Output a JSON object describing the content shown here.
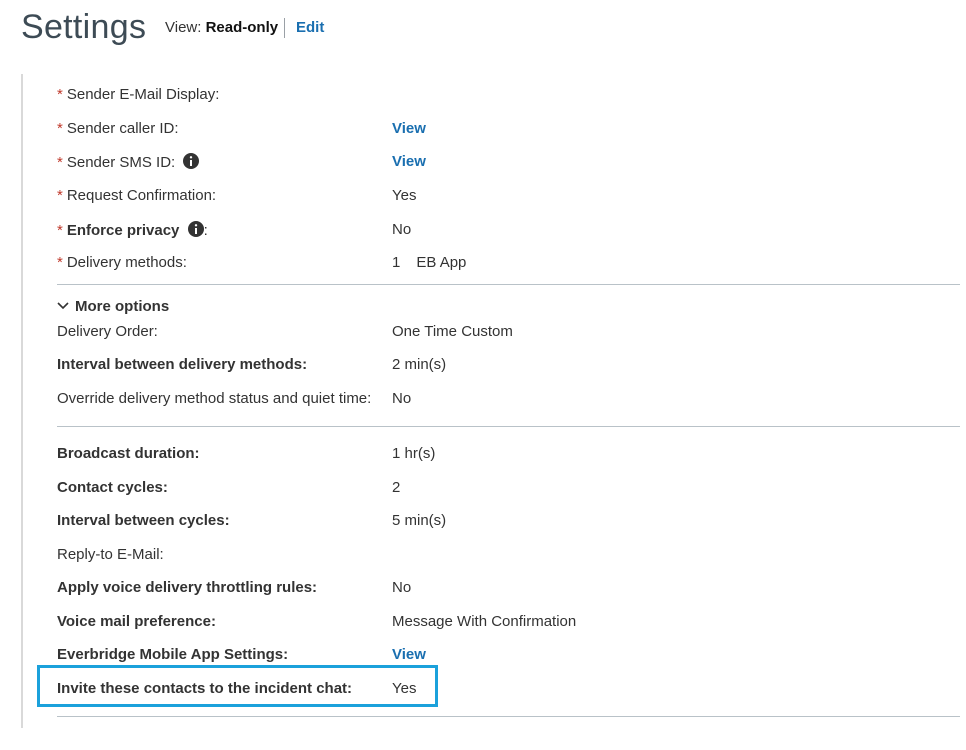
{
  "header": {
    "title": "Settings",
    "view_label": "View:",
    "view_value": "Read-only",
    "edit_label": "Edit"
  },
  "fields": {
    "sender_email": {
      "label": "Sender E-Mail Display:"
    },
    "sender_caller": {
      "label": "Sender caller ID:",
      "value": "View"
    },
    "sender_sms": {
      "label": "Sender SMS ID:",
      "value": "View"
    },
    "request_conf": {
      "label": "Request Confirmation:",
      "value": "Yes"
    },
    "enforce_privacy": {
      "label": "Enforce privacy",
      "suffix": ":",
      "value": "No"
    },
    "delivery_methods": {
      "label": "Delivery methods:",
      "index": "1",
      "value": "EB App"
    }
  },
  "more_options": {
    "label": "More options",
    "delivery_order": {
      "label": "Delivery Order:",
      "value": "One Time Custom"
    },
    "interval_methods": {
      "label": "Interval between delivery methods:",
      "value": "2 min(s)"
    },
    "override_status": {
      "label": "Override delivery method status and quiet time:",
      "value": "No"
    }
  },
  "broadcast": {
    "duration": {
      "label": "Broadcast duration:",
      "value": "1 hr(s)"
    },
    "contact_cycles": {
      "label": "Contact cycles:",
      "value": "2"
    },
    "interval_cycles": {
      "label": "Interval between cycles:",
      "value": "5 min(s)"
    },
    "reply_to": {
      "label": "Reply-to E-Mail:"
    },
    "throttling": {
      "label": "Apply voice delivery throttling rules:",
      "value": "No"
    },
    "voicemail": {
      "label": "Voice mail preference:",
      "value": "Message With Confirmation"
    },
    "mobile_app": {
      "label": "Everbridge Mobile App Settings:",
      "value": "View"
    },
    "invite_chat": {
      "label": "Invite these contacts to the incident chat:",
      "value": "Yes"
    }
  },
  "required_marker": "*",
  "colors": {
    "link": "#1a6fb0",
    "required": "#c0392b",
    "highlight": "#1ba1db"
  }
}
